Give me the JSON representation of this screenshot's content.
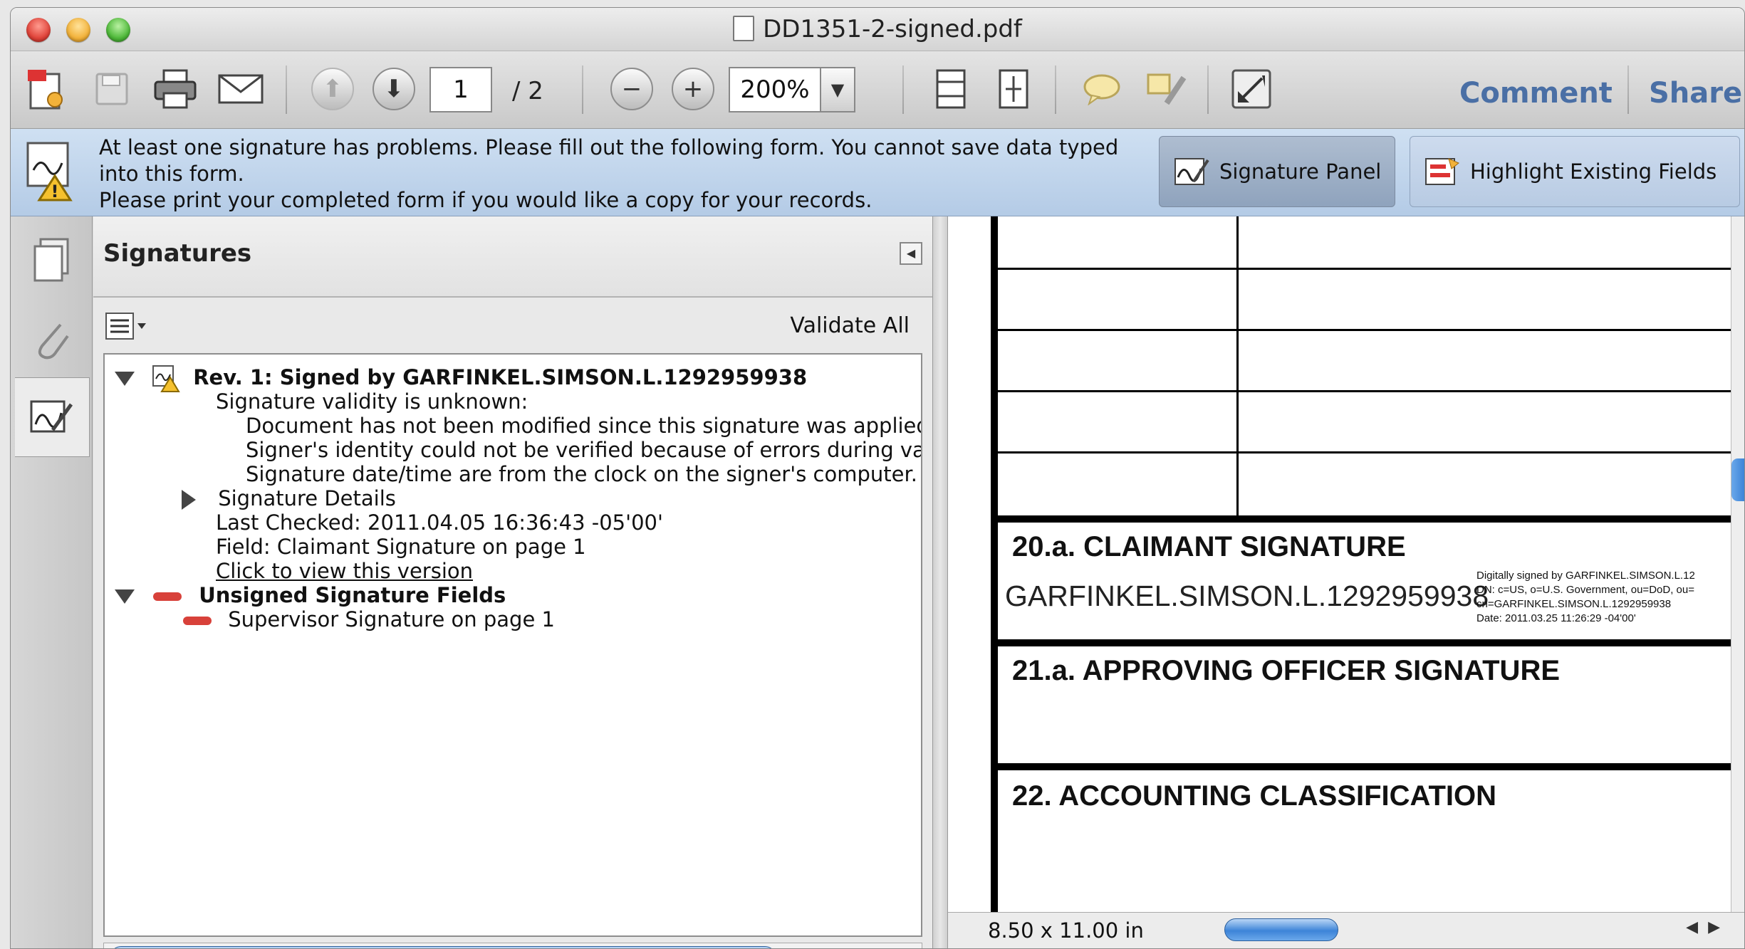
{
  "window": {
    "title": "DD1351-2-signed.pdf"
  },
  "toolbar": {
    "current_page": "1",
    "total_pages": "/ 2",
    "zoom": "200%",
    "comment_label": "Comment",
    "share_label": "Share"
  },
  "message": {
    "lines": [
      "At least one signature has problems.  Please fill out the following form. You cannot save data typed",
      "into this form.",
      "Please print your completed form if you would like a copy for your records."
    ],
    "signature_panel_label": "Signature Panel",
    "highlight_fields_label": "Highlight Existing Fields"
  },
  "signatures": {
    "title": "Signatures",
    "validate_all": "Validate All",
    "rev_title": "Rev. 1: Signed by GARFINKEL.SIMSON.L.1292959938",
    "validity": "Signature validity is unknown:",
    "detail_1": "Document has not been modified since this signature was applied",
    "detail_2": "Signer's identity could not be verified because of errors during vali",
    "detail_3": "Signature date/time are from the clock on the signer's computer.",
    "details_label": "Signature Details",
    "last_checked": "Last Checked: 2011.04.05 16:36:43 -05'00'",
    "field": "Field: Claimant Signature on page 1",
    "view_version": "Click to view this version",
    "unsigned_title": "Unsigned Signature Fields",
    "unsigned_item": "Supervisor Signature on page 1"
  },
  "document": {
    "field_20": "20.a. CLAIMANT SIGNATURE",
    "signer_name": "GARFINKEL.SIMSON.L.1292959938",
    "sig_line_1": "Digitally signed by GARFINKEL.SIMSON.L.12",
    "sig_line_2": "DN: c=US, o=U.S. Government, ou=DoD, ou=",
    "sig_line_3": "cn=GARFINKEL.SIMSON.L.1292959938",
    "sig_line_4": "Date: 2011.03.25 11:26:29 -04'00'",
    "field_21": "21.a. APPROVING OFFICER SIGNATURE",
    "field_22": "22. ACCOUNTING CLASSIFICATION",
    "page_size": "8.50 x 11.00 in"
  }
}
